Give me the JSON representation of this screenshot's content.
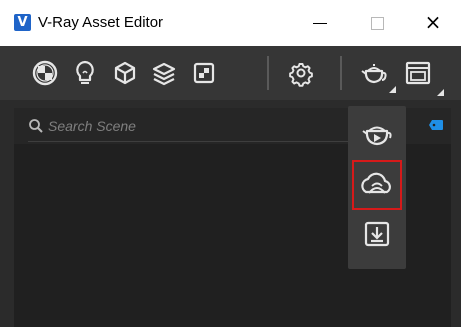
{
  "window": {
    "title": "V-Ray Asset Editor",
    "logo_letter": "V",
    "controls": {
      "minimize": "minimize-icon",
      "maximize": "maximize-icon",
      "close": "×"
    }
  },
  "toolbar": {
    "buttons": [
      {
        "icon": "materials-icon"
      },
      {
        "icon": "lights-icon"
      },
      {
        "icon": "geometry-icon"
      },
      {
        "icon": "layers-icon"
      },
      {
        "icon": "textures-icon"
      },
      {
        "icon": "settings-icon"
      },
      {
        "icon": "render-teapot-icon",
        "has_dropdown": false
      },
      {
        "icon": "frame-buffer-icon",
        "has_dropdown": true
      }
    ]
  },
  "search": {
    "placeholder": "Search Scene",
    "value": ""
  },
  "render_menu": {
    "items": [
      {
        "icon": "render-interactive-icon"
      },
      {
        "icon": "render-cloud-icon",
        "highlighted": true
      },
      {
        "icon": "export-vrscene-icon"
      }
    ]
  },
  "colors": {
    "accent": "#1f8fe6",
    "highlight_border": "#d61a1a",
    "logo": "#1f64c8"
  }
}
